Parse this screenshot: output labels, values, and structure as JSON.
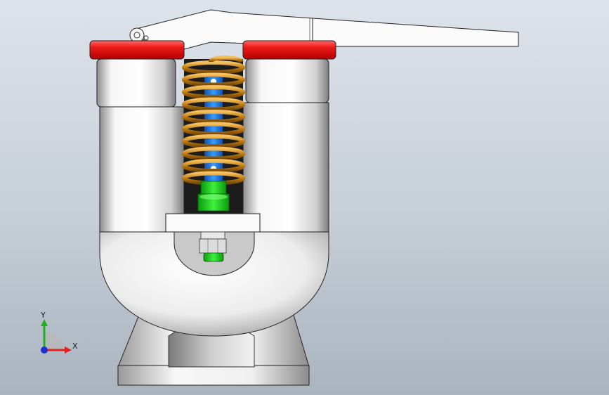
{
  "triad": {
    "x_label": "X",
    "y_label": "Y",
    "x_color": "#e0201c",
    "y_color": "#22b022",
    "z_color": "#1a2fd8"
  },
  "colors": {
    "background_top": "#dde3ea",
    "background_bottom": "#aab4bf",
    "cap": "#e01018",
    "spring": "#c08018",
    "rod": "#1e7ae8",
    "valve_seat": "#22cc22",
    "body": "#f2f2f2"
  },
  "icons": [
    "axis-triad-icon",
    "pin-icon"
  ]
}
